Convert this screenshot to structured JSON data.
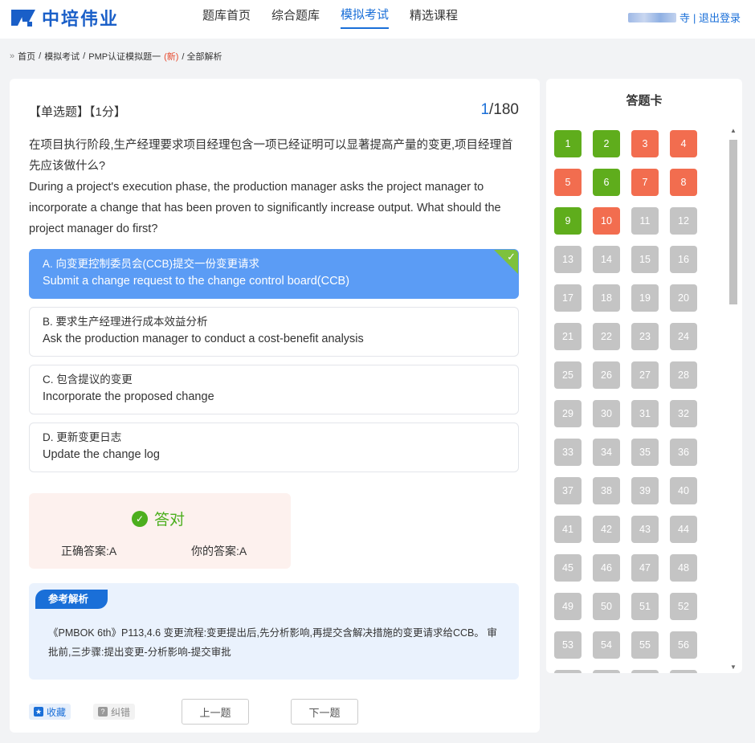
{
  "header": {
    "logo_text": "中培伟业",
    "nav": [
      "题库首页",
      "综合题库",
      "模拟考试",
      "精选课程"
    ],
    "active_nav": "模拟考试",
    "user_suffix": "寺",
    "logout": "| 退出登录"
  },
  "breadcrumb": {
    "home": "首页",
    "sep": "/",
    "mock": "模拟考试",
    "exam": "PMP认证模拟题一",
    "new_tag": "(新)",
    "current": "/ 全部解析"
  },
  "question": {
    "type": "【单选题】",
    "score": "【1分】",
    "current": "1",
    "total": "/180",
    "text_cn": "在项目执行阶段,生产经理要求项目经理包含一项已经证明可以显著提高产量的变更,项目经理首先应该做什么?",
    "text_en": "During a project's execution phase, the production manager asks the project manager to incorporate a change that has been proven to significantly increase output. What should the project manager do first?"
  },
  "options": [
    {
      "cn": "A.  向变更控制委员会(CCB)提交一份变更请求",
      "en": "Submit a change request to the change control board(CCB)",
      "correct": true
    },
    {
      "cn": "B.  要求生产经理进行成本效益分析",
      "en": "Ask the production manager to conduct a cost-benefit analysis",
      "correct": false
    },
    {
      "cn": "C.  包含提议的变更",
      "en": "Incorporate the proposed change",
      "correct": false
    },
    {
      "cn": "D.  更新变更日志",
      "en": "Update the change log",
      "correct": false
    }
  ],
  "result": {
    "title": "答对",
    "correct_label": "正确答案:A",
    "yours_label": "你的答案:A"
  },
  "analysis": {
    "tag": "参考解析",
    "text": "《PMBOK 6th》P113,4.6 变更流程:变更提出后,先分析影响,再提交含解决措施的变更请求给CCB。 审批前,三步骤:提出变更-分析影响-提交审批"
  },
  "actions": {
    "favorite": "收藏",
    "report_error": "纠错",
    "prev": "上一题",
    "next": "下一题"
  },
  "answer_card": {
    "title": "答题卡",
    "green": [
      1,
      2,
      6,
      9
    ],
    "red": [
      3,
      4,
      5,
      7,
      8,
      10
    ],
    "count_visible": 60
  },
  "colors": {
    "accent": "#1a6fd8",
    "correct_option": "#5b9cf5",
    "green": "#5fad1c",
    "red": "#f26d4f",
    "grey": "#c4c4c4"
  }
}
